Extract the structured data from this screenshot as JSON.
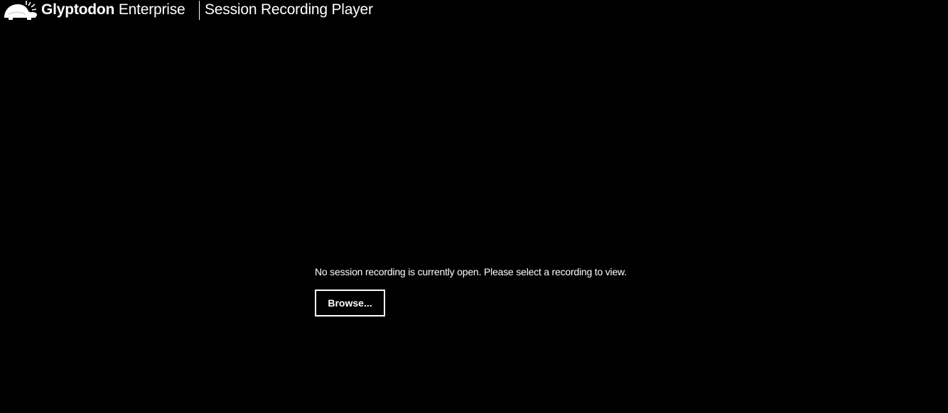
{
  "header": {
    "logo_icon": "glyptodon-logo-icon",
    "brand_bold": "Glyptodon",
    "brand_light": "Enterprise",
    "app_title": "Session Recording Player"
  },
  "main": {
    "message": "No session recording is currently open. Please select a recording to view.",
    "browse_label": "Browse..."
  },
  "colors": {
    "background": "#000000",
    "foreground": "#ffffff"
  }
}
